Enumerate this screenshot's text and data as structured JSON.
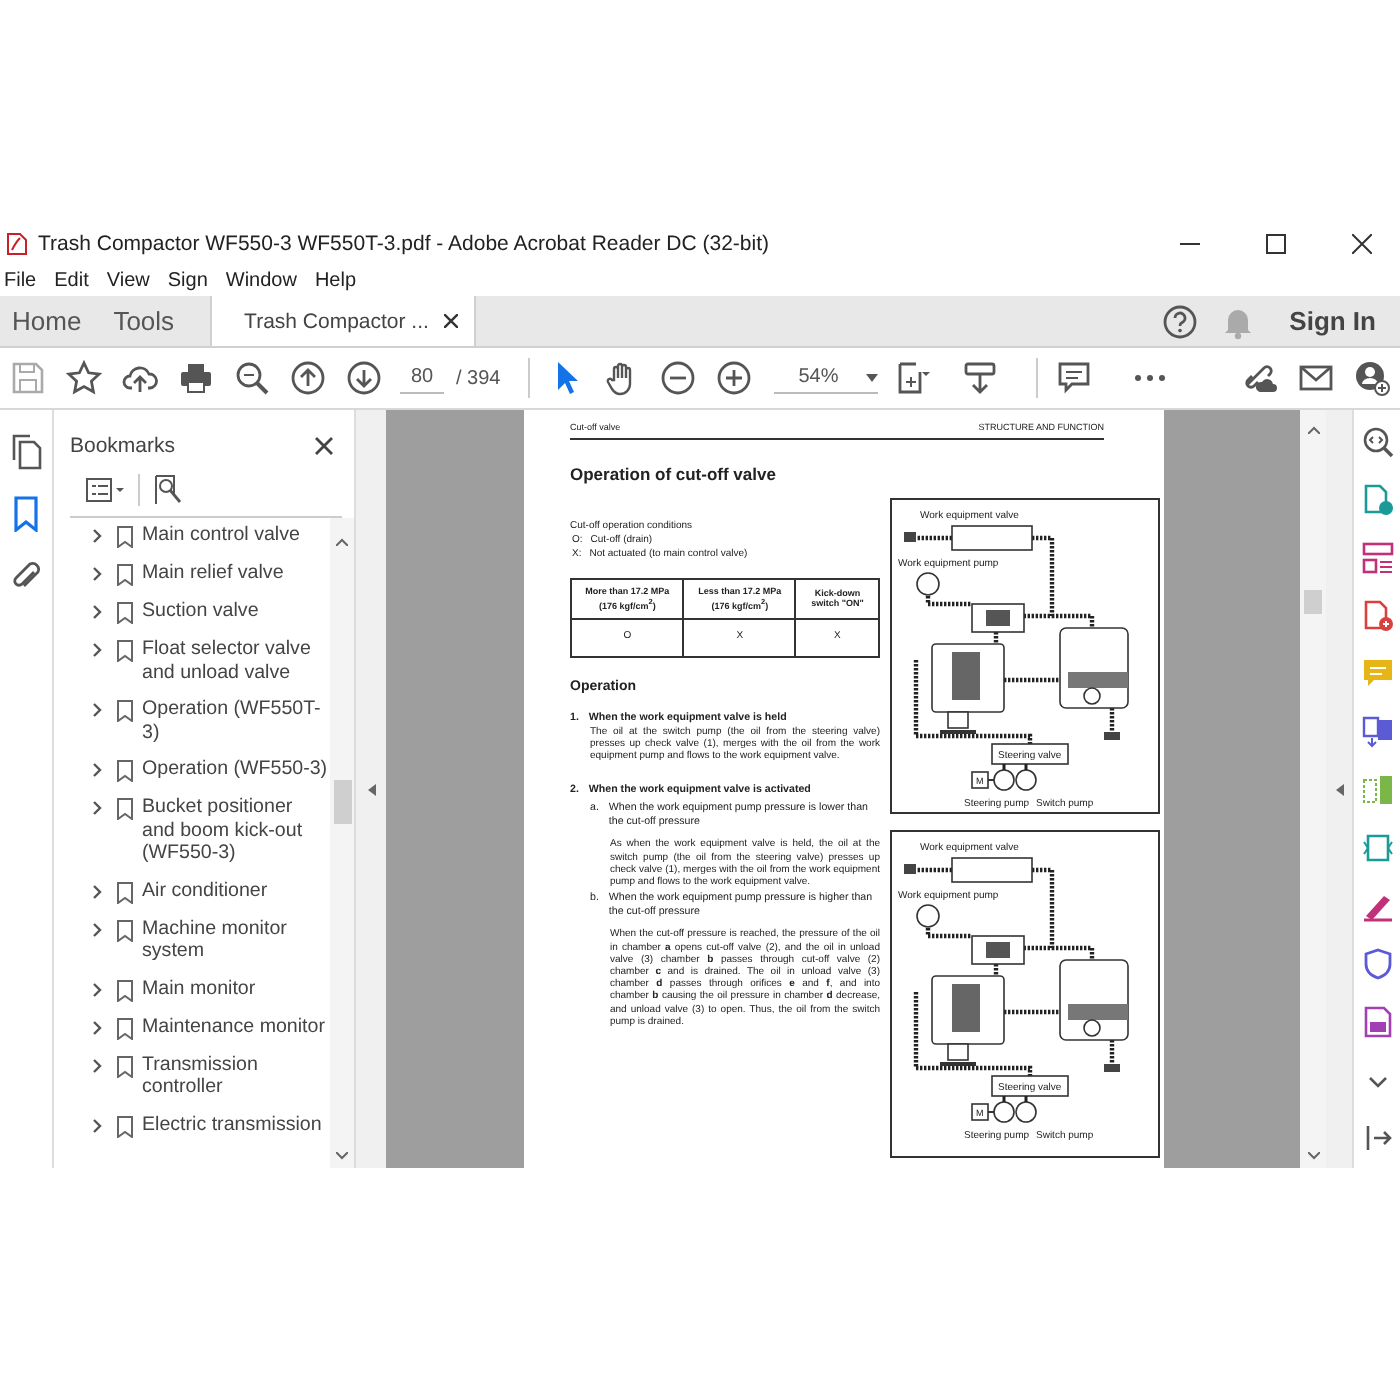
{
  "window": {
    "title": "Trash Compactor WF550-3 WF550T-3.pdf - Adobe Acrobat Reader DC (32-bit)"
  },
  "menu": [
    "File",
    "Edit",
    "View",
    "Sign",
    "Window",
    "Help"
  ],
  "tabs": [
    {
      "label": "Home",
      "selected": false,
      "closable": false
    },
    {
      "label": "Tools",
      "selected": false,
      "closable": false
    },
    {
      "label": "Trash Compactor ...",
      "selected": true,
      "closable": true
    }
  ],
  "account": {
    "sign_in": "Sign In"
  },
  "toolbar": {
    "page": "80",
    "page_total": "/ 394",
    "zoom": "54%",
    "pointer_tools": [
      {
        "kind": "select",
        "selected": true
      },
      {
        "kind": "hand",
        "selected": false
      }
    ]
  },
  "left_rail": [
    {
      "kind": "pages",
      "selected": false
    },
    {
      "kind": "bookmarks",
      "selected": true
    },
    {
      "kind": "attachments",
      "selected": false
    }
  ],
  "bookmarks": {
    "title": "Bookmarks",
    "items": [
      {
        "label": "Main control valve",
        "expanded": false
      },
      {
        "label": "Main relief valve",
        "expanded": false
      },
      {
        "label": "Suction valve",
        "expanded": false
      },
      {
        "label": "Float selector valve and unload valve",
        "expanded": false
      },
      {
        "label": "Operation (WF550T-3)",
        "expanded": false
      },
      {
        "label": "Operation (WF550-3)",
        "expanded": false
      },
      {
        "label": "Bucket positioner and boom kick-out (WF550-3)",
        "expanded": false
      },
      {
        "label": "Air conditioner",
        "expanded": false
      },
      {
        "label": "Machine monitor system",
        "expanded": false
      },
      {
        "label": "Main monitor",
        "expanded": false
      },
      {
        "label": "Maintenance monitor",
        "expanded": false
      },
      {
        "label": "Transmission controller",
        "expanded": false
      },
      {
        "label": "Electric transmission",
        "expanded": false
      }
    ]
  },
  "page": {
    "header_left": "Cut-off valve",
    "header_right": "STRUCTURE AND FUNCTION",
    "heading": "Operation of cut-off valve",
    "conditions_title": "Cut-off operation conditions",
    "conditions": [
      {
        "code": "O:",
        "text": "Cut-off (drain)"
      },
      {
        "code": "X:",
        "text": "Not actuated (to main control valve)"
      }
    ],
    "table": {
      "columns": [
        "More than 17.2 MPa (176 kgf/cm$^{2}$)",
        "Less than 17.2 MPa (176 kgf/cm$^{2}$)",
        "Kick-down switch \"ON\""
      ],
      "rows": [
        [
          "O",
          "X",
          "X"
        ]
      ]
    },
    "section": "Operation",
    "steps": [
      {
        "number": "1.",
        "title": "When the work equipment valve is held",
        "body": "The oil at the switch pump (the oil from the steering valve) presses up check valve (1), merges with the oil from the work equipment pump and flows to the work equipment valve."
      },
      {
        "number": "2.",
        "title": "When the work equipment valve is activated",
        "substeps": [
          {
            "letter": "a.",
            "title": "When the work equipment pump pressure is lower than the cut-off pressure",
            "body": "As when the work equipment valve is held, the oil at the switch pump (the oil from the steering valve) presses up check valve (1), merges with the oil from the work equipment pump and flows to the work equipment valve."
          },
          {
            "letter": "b.",
            "title": "When the work equipment pump pressure is higher than the cut-off pressure",
            "body": "When the cut-off pressure is reached, the pressure of the oil in chamber **a** opens cut-off valve (2), and the oil in unload valve (3) chamber **b** passes through cut-off valve (2) chamber **c** and is drained. The oil in unload valve (3) chamber **d** passes through orifices **e** and **f**, and into chamber **b** causing the oil pressure in chamber **d** decrease, and unload valve (3) to open. Thus, the oil from the switch pump is drained."
          }
        ]
      }
    ],
    "figures": [
      {
        "valve": "Work equipment valve",
        "pump": "Work equipment pump",
        "steering_valve": "Steering valve",
        "motor": "M",
        "steering_pump": "Steering pump",
        "switch_pump": "Switch pump"
      },
      {
        "valve": "Work equipment valve",
        "pump": "Work equipment pump",
        "steering_valve": "Steering valve",
        "motor": "M",
        "steering_pump": "Steering pump",
        "switch_pump": "Switch pump"
      }
    ]
  }
}
